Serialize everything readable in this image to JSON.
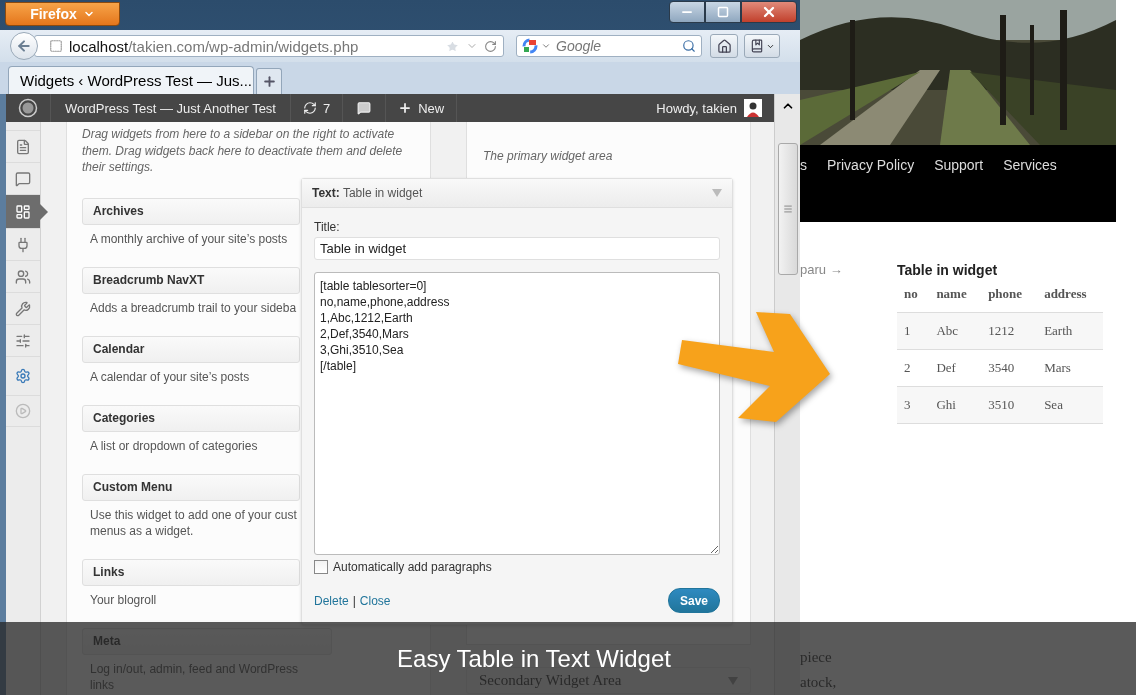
{
  "browser": {
    "menu_button": "Firefox",
    "url_host": "localhost",
    "url_path": "/takien.com/wp-admin/widgets.php",
    "search": {
      "placeholder": "Google"
    },
    "tab": {
      "title": "Widgets ‹ WordPress Test — Jus...",
      "selected": true
    }
  },
  "admin_bar": {
    "site": "WordPress Test — Just Another Test",
    "updates": "7",
    "new": "New",
    "greeting": "Howdy, takien"
  },
  "admin_menu": [
    {
      "kind": "pages",
      "selected": false
    },
    {
      "kind": "comments",
      "selected": false
    },
    {
      "kind": "appearance",
      "selected": true
    },
    {
      "kind": "plugins",
      "selected": false
    },
    {
      "kind": "users",
      "selected": false
    },
    {
      "kind": "tools",
      "selected": false
    },
    {
      "kind": "settings",
      "selected": false
    },
    {
      "kind": "extra",
      "selected": false
    },
    {
      "kind": "collapse",
      "selected": false
    }
  ],
  "available_widgets": {
    "description": "Drag widgets from here to a sidebar on the right to activate them. Drag widgets back here to deactivate them and delete their settings.",
    "widgets": [
      {
        "title": "Archives",
        "description": "A monthly archive of your site’s posts"
      },
      {
        "title": "Breadcrumb NavXT",
        "description": "Adds a breadcrumb trail to your sideba"
      },
      {
        "title": "Calendar",
        "description": "A calendar of your site’s posts"
      },
      {
        "title": "Categories",
        "description": "A list or dropdown of categories"
      },
      {
        "title": "Custom Menu",
        "description": "Use this widget to add one of your cust\nmenus as a widget."
      },
      {
        "title": "Links",
        "description": "Your blogroll"
      },
      {
        "title": "Meta",
        "description": "Log in/out, admin, feed and WordPress\nlinks"
      }
    ]
  },
  "primary_area": {
    "description": "The primary widget area"
  },
  "secondary_area": {
    "title": "Secondary Widget Area"
  },
  "widget_editor": {
    "header": "**Text:** Table in widget",
    "title_label": "Title:",
    "title_value": "Table in widget",
    "content": "[table tablesorter=0]\nno,name,phone,address\n1,Abc,1212,Earth\n2,Def,3540,Mars\n3,Ghi,3510,Sea\n[/table]",
    "auto_paragraphs": {
      "label": "Automatically add paragraphs",
      "checked": false
    },
    "links": [
      "Delete",
      "Close"
    ],
    "separator": "|",
    "save": "Save"
  },
  "site": {
    "nav": [
      "s",
      "Privacy Policy",
      "Support",
      "Services"
    ],
    "prev_link": "paru →",
    "widget": {
      "title": "Table in widget",
      "table": {
        "columns": [
          "no",
          "name",
          "phone",
          "address"
        ],
        "rows": [
          [
            "1",
            "Abc",
            "1212",
            "Earth"
          ],
          [
            "2",
            "Def",
            "3540",
            "Mars"
          ],
          [
            "3",
            "Ghi",
            "3510",
            "Sea"
          ]
        ]
      }
    },
    "body_lines": [
      "piece",
      "atock,"
    ]
  },
  "caption": "Easy Table in Text Widget"
}
